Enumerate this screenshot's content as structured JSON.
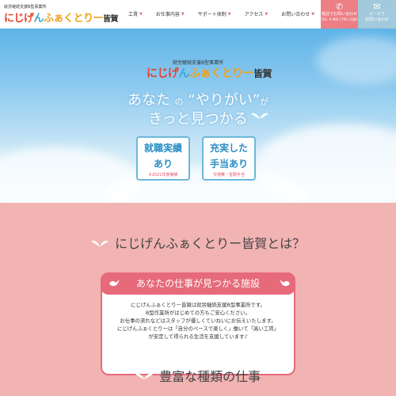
{
  "header": {
    "logo_sub": "就労継続支援B型事業所",
    "logo_parts": [
      "にじげ",
      "ん",
      "ふぁくとりー",
      "皆賀"
    ],
    "nav": [
      {
        "label": "工賃"
      },
      {
        "label": "お仕事内容"
      },
      {
        "label": "サポート体制"
      },
      {
        "label": "アクセス"
      },
      {
        "label": "お問い合わせ"
      }
    ],
    "tel_button": {
      "label": "電話でお問い合わせ",
      "small": "TEL: 0-990-7795 (代表)"
    },
    "mail_button": {
      "label": "メールで",
      "small": "お問い合わせ"
    }
  },
  "hero": {
    "sub": "就労継続支援B型事業所",
    "logo_parts": [
      "にじげ",
      "ん",
      "ふぁくとりー",
      "皆賀"
    ],
    "catch_a": "あなた",
    "catch_no": "の",
    "catch_b": "“やりがい”",
    "catch_ga": "が",
    "catch_line2": "きっと見つかる",
    "badges": [
      {
        "line1": "就職実績",
        "line2": "あり",
        "note": "※2021年度実績"
      },
      {
        "line1": "充実した",
        "line2": "手当あり",
        "note": "交通費・皆勤手当"
      }
    ]
  },
  "about": {
    "title": "にじげんふぁくとりー皆賀とは？",
    "card_heading": "あなたの仕事が見つかる施設",
    "card_lines": [
      "にじげんふぁくとりー皆賀は就労継続支援B型事業所です。",
      "B型作業所がはじめての方もご安心ください。",
      "お仕事の流れなどはスタッフが優しくていねいにお伝えいたします。",
      "にじげんふぁくとりーは「自分のペースで楽しく」働いて「高い工賃」",
      "が安定して得られる生活を支援しています♪"
    ],
    "next_title": "豊富な種類の仕事"
  },
  "icons": [
    "phone-icon",
    "mail-icon",
    "wing-icon",
    "bird-icon"
  ],
  "colors": {
    "accent_pink": "#e66a7a",
    "tel_bg": "#ec7e84",
    "mail_bg": "#a3c9dc",
    "badge_blue": "#2b8ec4"
  }
}
